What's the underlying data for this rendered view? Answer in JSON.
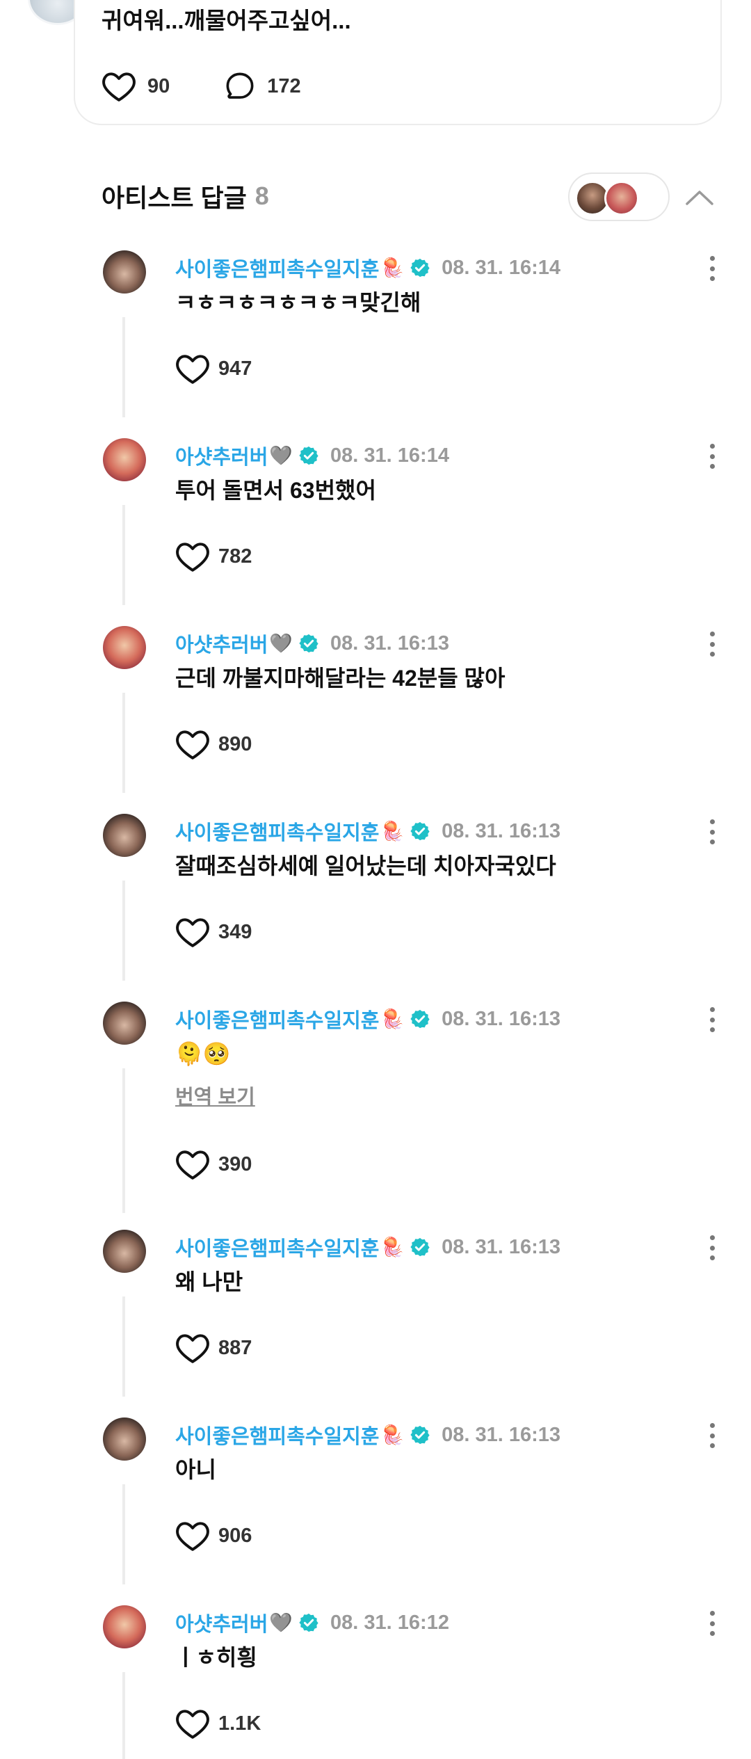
{
  "post": {
    "text": "귀여워...깨물어주고싶어...",
    "likes": "90",
    "comments": "172"
  },
  "artist_replies": {
    "title": "아티스트 답글",
    "count": "8"
  },
  "replies": [
    {
      "author": "사이좋은햄피촉수일지훈",
      "emoji": "🪼",
      "time": "08. 31. 16:14",
      "text": "ㅋㅎㅋㅎㅋㅎㅋㅎㅋ맞긴해",
      "likes": "947"
    },
    {
      "author": "아샷추러버",
      "emoji": "🩶",
      "time": "08. 31. 16:14",
      "text": "투어 돌면서 63번했어",
      "likes": "782"
    },
    {
      "author": "아샷추러버",
      "emoji": "🩶",
      "time": "08. 31. 16:13",
      "text": "근데 까불지마해달라는 42분들 많아",
      "likes": "890"
    },
    {
      "author": "사이좋은햄피촉수일지훈",
      "emoji": "🪼",
      "time": "08. 31. 16:13",
      "text": "잘때조심하세예 일어났는데 치아자국있다",
      "likes": "349"
    },
    {
      "author": "사이좋은햄피촉수일지훈",
      "emoji": "🪼",
      "time": "08. 31. 16:13",
      "text": "🫠🥺",
      "translate": "번역 보기",
      "likes": "390"
    },
    {
      "author": "사이좋은햄피촉수일지훈",
      "emoji": "🪼",
      "time": "08. 31. 16:13",
      "text": "왜 나만",
      "likes": "887"
    },
    {
      "author": "사이좋은햄피촉수일지훈",
      "emoji": "🪼",
      "time": "08. 31. 16:13",
      "text": "아니",
      "likes": "906"
    },
    {
      "author": "아샷추러버",
      "emoji": "🩶",
      "time": "08. 31. 16:12",
      "text": "ㅣㅎ히힁",
      "likes": "1.1K"
    }
  ],
  "colors": {
    "author": "#2aa6e6",
    "verified": "#1fc0c8",
    "meta_gray": "#9a9a9a",
    "thread_line": "#ececec"
  },
  "icons": {
    "like": "heart-outline-icon",
    "comment": "speech-bubble-icon",
    "verified": "verified-badge-icon",
    "more": "more-vertical-icon",
    "collapse": "chevron-up-icon"
  }
}
